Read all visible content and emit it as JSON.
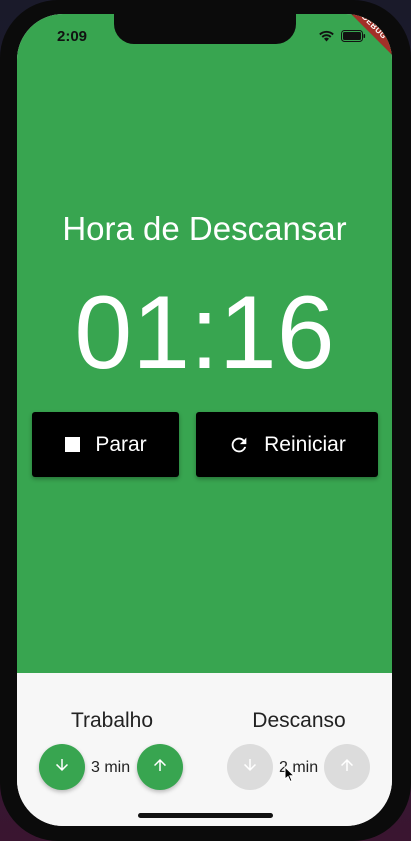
{
  "status_bar": {
    "time": "2:09",
    "debug_label": "DEBUG"
  },
  "timer": {
    "mode_title": "Hora de Descansar",
    "display": "01:16"
  },
  "controls": {
    "stop_label": "Parar",
    "restart_label": "Reiniciar"
  },
  "settings": {
    "work": {
      "label": "Trabalho",
      "value": "3 min"
    },
    "rest": {
      "label": "Descanso",
      "value": "2 min"
    }
  },
  "colors": {
    "primary_green": "#38a550",
    "button_black": "#000000",
    "disabled_gray": "#dcdcdc"
  },
  "icons": {
    "stop": "stop-icon",
    "restart": "refresh-icon",
    "decrease": "arrow-down-icon",
    "increase": "arrow-up-icon"
  }
}
